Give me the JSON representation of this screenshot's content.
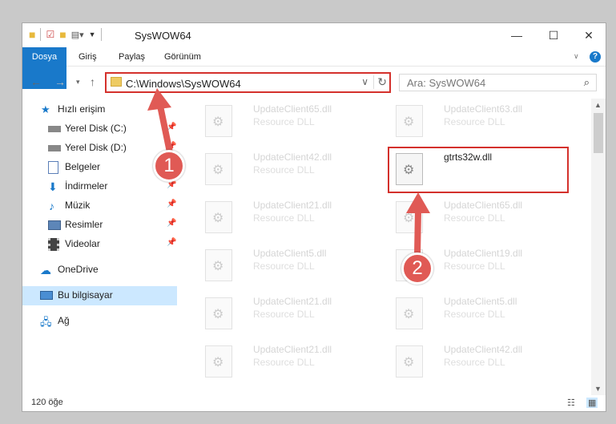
{
  "window": {
    "title": "SysWOW64"
  },
  "ribbon": {
    "tabs": [
      "Dosya",
      "Giriş",
      "Paylaş",
      "Görünüm"
    ]
  },
  "address": {
    "path": "C:\\Windows\\SysWOW64"
  },
  "search": {
    "placeholder": "Ara: SysWOW64"
  },
  "sidebar": {
    "items": [
      {
        "label": "Hızlı erişim",
        "icon": "star-icon"
      },
      {
        "label": "Yerel Disk (C:)",
        "icon": "drive-icon",
        "pinned": true
      },
      {
        "label": "Yerel Disk (D:)",
        "icon": "drive-icon",
        "pinned": true
      },
      {
        "label": "Belgeler",
        "icon": "document-icon",
        "pinned": true
      },
      {
        "label": "İndirmeler",
        "icon": "download-icon",
        "pinned": true
      },
      {
        "label": "Müzik",
        "icon": "music-icon",
        "pinned": true
      },
      {
        "label": "Resimler",
        "icon": "pictures-icon",
        "pinned": true
      },
      {
        "label": "Videolar",
        "icon": "video-icon",
        "pinned": true
      },
      {
        "label": "OneDrive",
        "icon": "cloud-icon"
      },
      {
        "label": "Bu bilgisayar",
        "icon": "computer-icon",
        "selected": true
      },
      {
        "label": "Ağ",
        "icon": "network-icon"
      }
    ]
  },
  "files": [
    {
      "name": "UpdateClient65.dll",
      "type": "Resource DLL"
    },
    {
      "name": "UpdateClient63.dll",
      "type": "Resource DLL"
    },
    {
      "name": "UpdateClient42.dll",
      "type": "Resource DLL"
    },
    {
      "name": "gtrts32w.dll",
      "type": "",
      "highlighted": true
    },
    {
      "name": "UpdateClient21.dll",
      "type": "Resource DLL"
    },
    {
      "name": "UpdateClient65.dll",
      "type": "Resource DLL"
    },
    {
      "name": "UpdateClient5.dll",
      "type": "Resource DLL"
    },
    {
      "name": "UpdateClient19.dll",
      "type": "Resource DLL"
    },
    {
      "name": "UpdateClient21.dll",
      "type": "Resource DLL"
    },
    {
      "name": "UpdateClient5.dll",
      "type": "Resource DLL"
    },
    {
      "name": "UpdateClient21.dll",
      "type": "Resource DLL"
    },
    {
      "name": "UpdateClient42.dll",
      "type": "Resource DLL"
    }
  ],
  "annotations": {
    "step1": "1",
    "step2": "2",
    "color": "#d4312c"
  },
  "status": {
    "count": "120 öğe"
  }
}
